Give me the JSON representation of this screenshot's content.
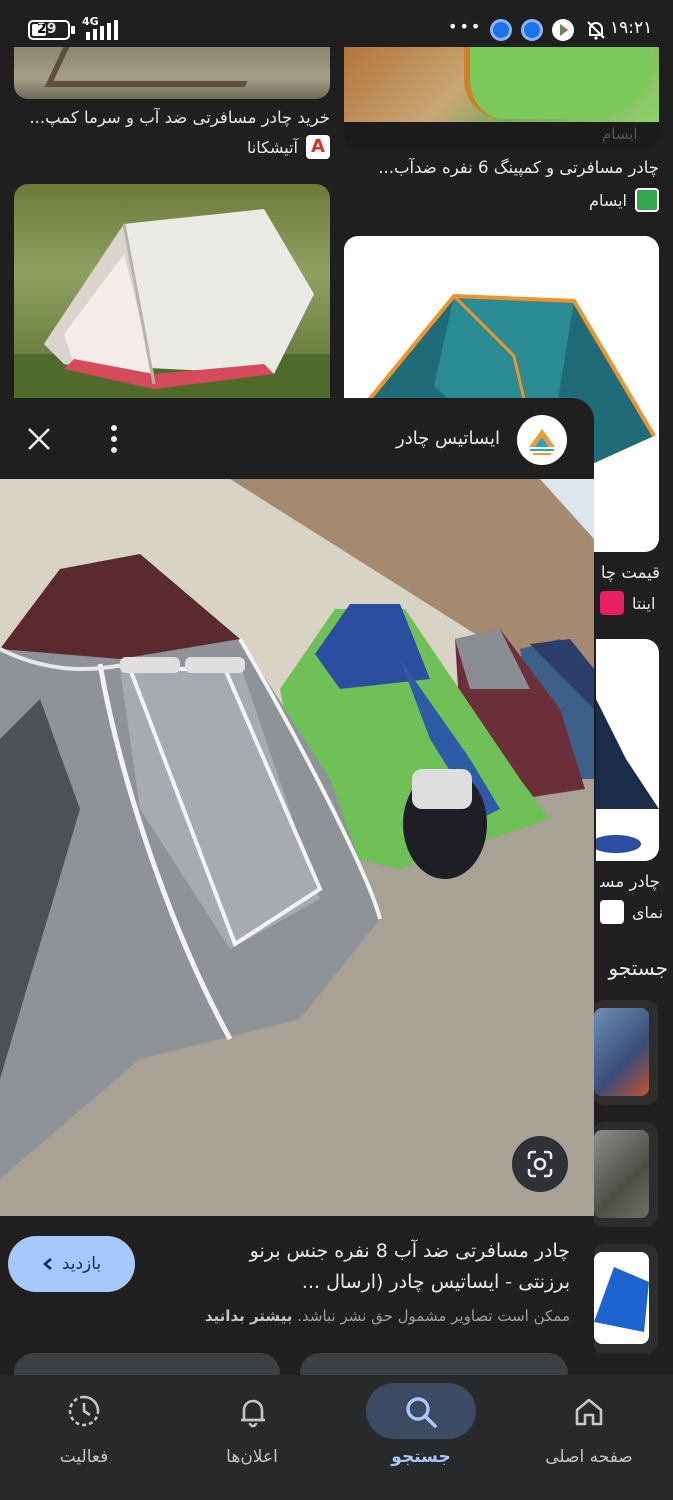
{
  "status_bar": {
    "time": "۱۹:۲۱",
    "battery": "29",
    "network": "4G",
    "overflow": "•••"
  },
  "results": {
    "item_top_left": {
      "caption": "خرید چادر مسافرتی ضد آب و سرما کمپ...",
      "source": "آتیشکانا"
    },
    "item_top_right": {
      "caption": "چادر مسافرتی و کمپینگ 6 نفره ضدآب...",
      "source": "ایسام"
    },
    "item_mid_right": {
      "caption": "قیمت چا",
      "source": "اینتا"
    },
    "item_low_right": {
      "caption": "چادر مسا",
      "source": "نمای"
    },
    "related_heading": "جستجو"
  },
  "preview": {
    "source_name": "ایساتیس چادر",
    "title": "چادر مسافرتی ضد آب 8 نفره جنس برنو برزنتی - ایساتیس چادر (ارسال ...",
    "disclaimer": "ممکن است تصاویر مشمول حق نشر نباشد.",
    "learn_more": "بیشتر بدانید",
    "visit_button": "بازدید"
  },
  "bottom_nav": {
    "items": [
      {
        "label": "صفحه اصلی",
        "icon": "home-icon"
      },
      {
        "label": "جستجو",
        "icon": "search-icon",
        "active": true
      },
      {
        "label": "اعلان‌ها",
        "icon": "bell-icon"
      },
      {
        "label": "فعالیت",
        "icon": "activity-icon"
      }
    ]
  },
  "colors": {
    "background": "#1f1f1f",
    "accent": "#a8c7fa",
    "nav_active_pill": "#3c4a63",
    "nav_background": "#28292a"
  }
}
